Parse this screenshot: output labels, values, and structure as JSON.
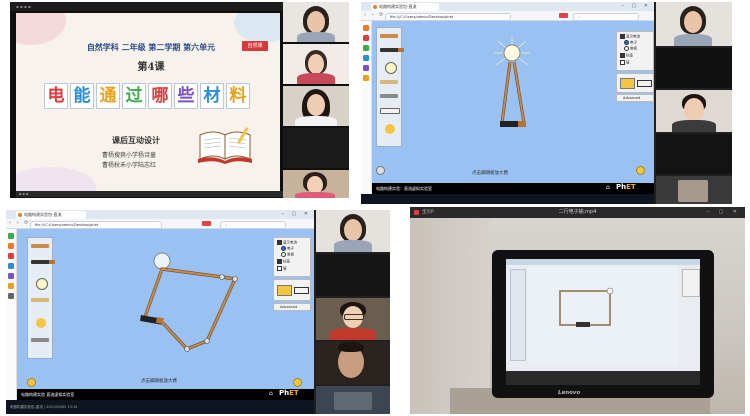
{
  "panel1": {
    "slide_header": "自然学科 二年级 第二学期 第六单元",
    "red_tag": "自然课",
    "lesson_no": "第4课",
    "title_chars": [
      "电",
      "能",
      "通",
      "过",
      "哪",
      "些",
      "材",
      "料"
    ],
    "title_colors": [
      "#e23b3b",
      "#2a8fd8",
      "#e8a21c",
      "#3bab4a",
      "#e23b3b",
      "#7b4fc8",
      "#2a8fd8",
      "#e8a21c"
    ],
    "subtitle": "课后互动设计",
    "author1": "曹杨搜爽小学杨诗童",
    "author2": "曹杨秋禾小学陆志红"
  },
  "panel2": {
    "tab_title": "电路构建实验包-直流",
    "url": "file:///C:/Users/admin/Desktop/phet",
    "caption": "点击脚踏板放大费",
    "sim_name": "电路构建实验：直流虚拟实验室",
    "logo": "PhET",
    "controls": [
      "显示电流",
      "电子",
      "常规",
      "标签",
      "值"
    ],
    "advanced_label": "Advanced"
  },
  "panel3": {
    "tab_title": "电路构建实验包-直流",
    "url": "file:///C:/Users/admin/Desktop/phet",
    "caption": "点击脚踏板放大费",
    "sim_name": "电路构建实验 直流虚拟实验室",
    "logo": "PhET",
    "controls": [
      "显示电流",
      "电子",
      "常规",
      "标签",
      "值"
    ],
    "advanced_label": "Advanced",
    "taskbar_text": "电路构建实验包-直流 | 2021/04/02 13:15"
  },
  "panel4": {
    "window_title": "二行电子输.mp4",
    "left_label": "宝贝P",
    "brand": "Lenovo"
  },
  "icons": [
    "zoom-icon",
    "home-icon",
    "lightbulb-icon",
    "battery-icon",
    "close-icon"
  ]
}
